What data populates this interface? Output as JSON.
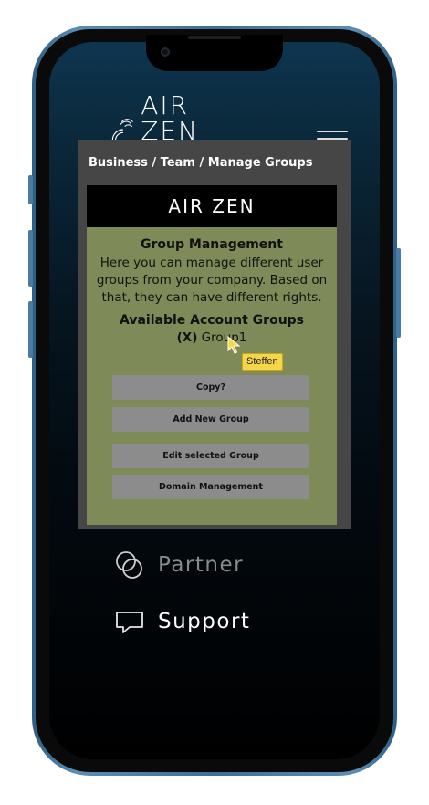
{
  "app": {
    "logo_text": "AIR ZEN"
  },
  "overlay": {
    "breadcrumb": "Business / Team / Manage Groups",
    "logo_text": "AIR ZEN",
    "group_management": {
      "title": "Group Management",
      "description": "Here you can manage different user groups from your company. Based on that, they can have different rights."
    },
    "available_groups": {
      "title": "Available Account Groups",
      "items": [
        {
          "remove_label": "(X)",
          "name": "Group1"
        }
      ]
    },
    "buttons": {
      "copy": "Copy?",
      "add_new_group": "Add New Group",
      "edit_selected_group": "Edit selected Group",
      "domain_management": "Domain Management"
    },
    "colors": {
      "panel_green": "#7e8a57",
      "button_gray": "#8c8c8c",
      "overlay_gray": "#464646"
    }
  },
  "nav": {
    "items": [
      {
        "label": "Partner",
        "icon": "partner-circles-icon"
      },
      {
        "label": "Support",
        "icon": "chat-bubble-icon"
      }
    ]
  },
  "cursor": {
    "tooltip": "Steffen"
  }
}
